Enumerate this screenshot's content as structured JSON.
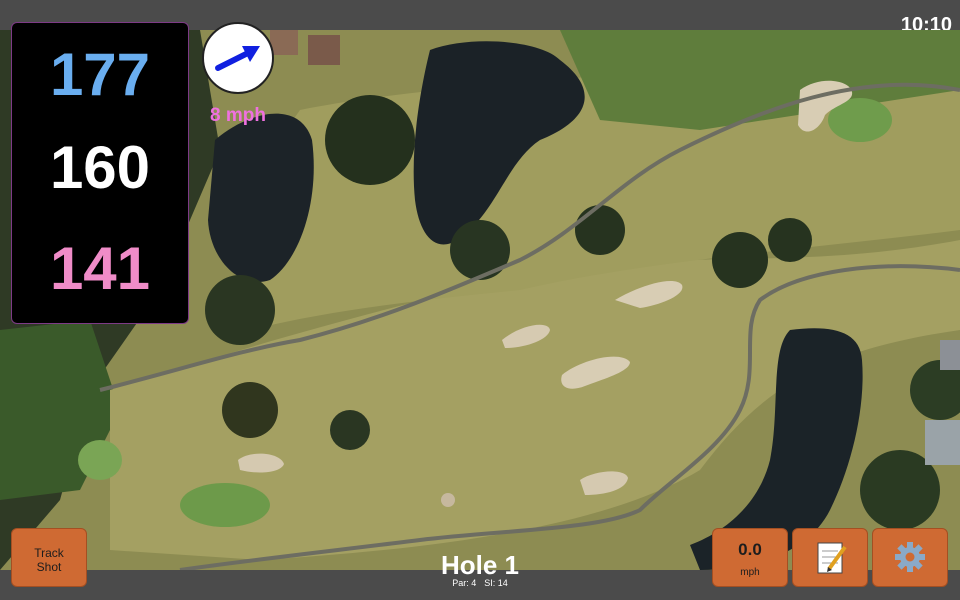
{
  "status_bar": {
    "time": "10:10"
  },
  "distances": {
    "back": "177",
    "middle": "160",
    "front": "141",
    "back_color": "#6aaef0",
    "middle_color": "#ffffff",
    "front_color": "#f08cc8"
  },
  "wind": {
    "speed_label": "8 mph",
    "arrow_icon": "right-arrow-icon"
  },
  "buttons": {
    "track_shot_line1": "Track",
    "track_shot_line2": "Shot",
    "wind_value": "0.0",
    "wind_unit": "mph",
    "notes_icon": "notepad-icon",
    "settings_icon": "gear-icon"
  },
  "hole": {
    "title": "Hole 1",
    "par": "Par: 4",
    "si": "SI: 14"
  },
  "colors": {
    "accent": "#cf6a33",
    "panel_border": "#7d3a86",
    "bar": "#4b4b4b"
  }
}
